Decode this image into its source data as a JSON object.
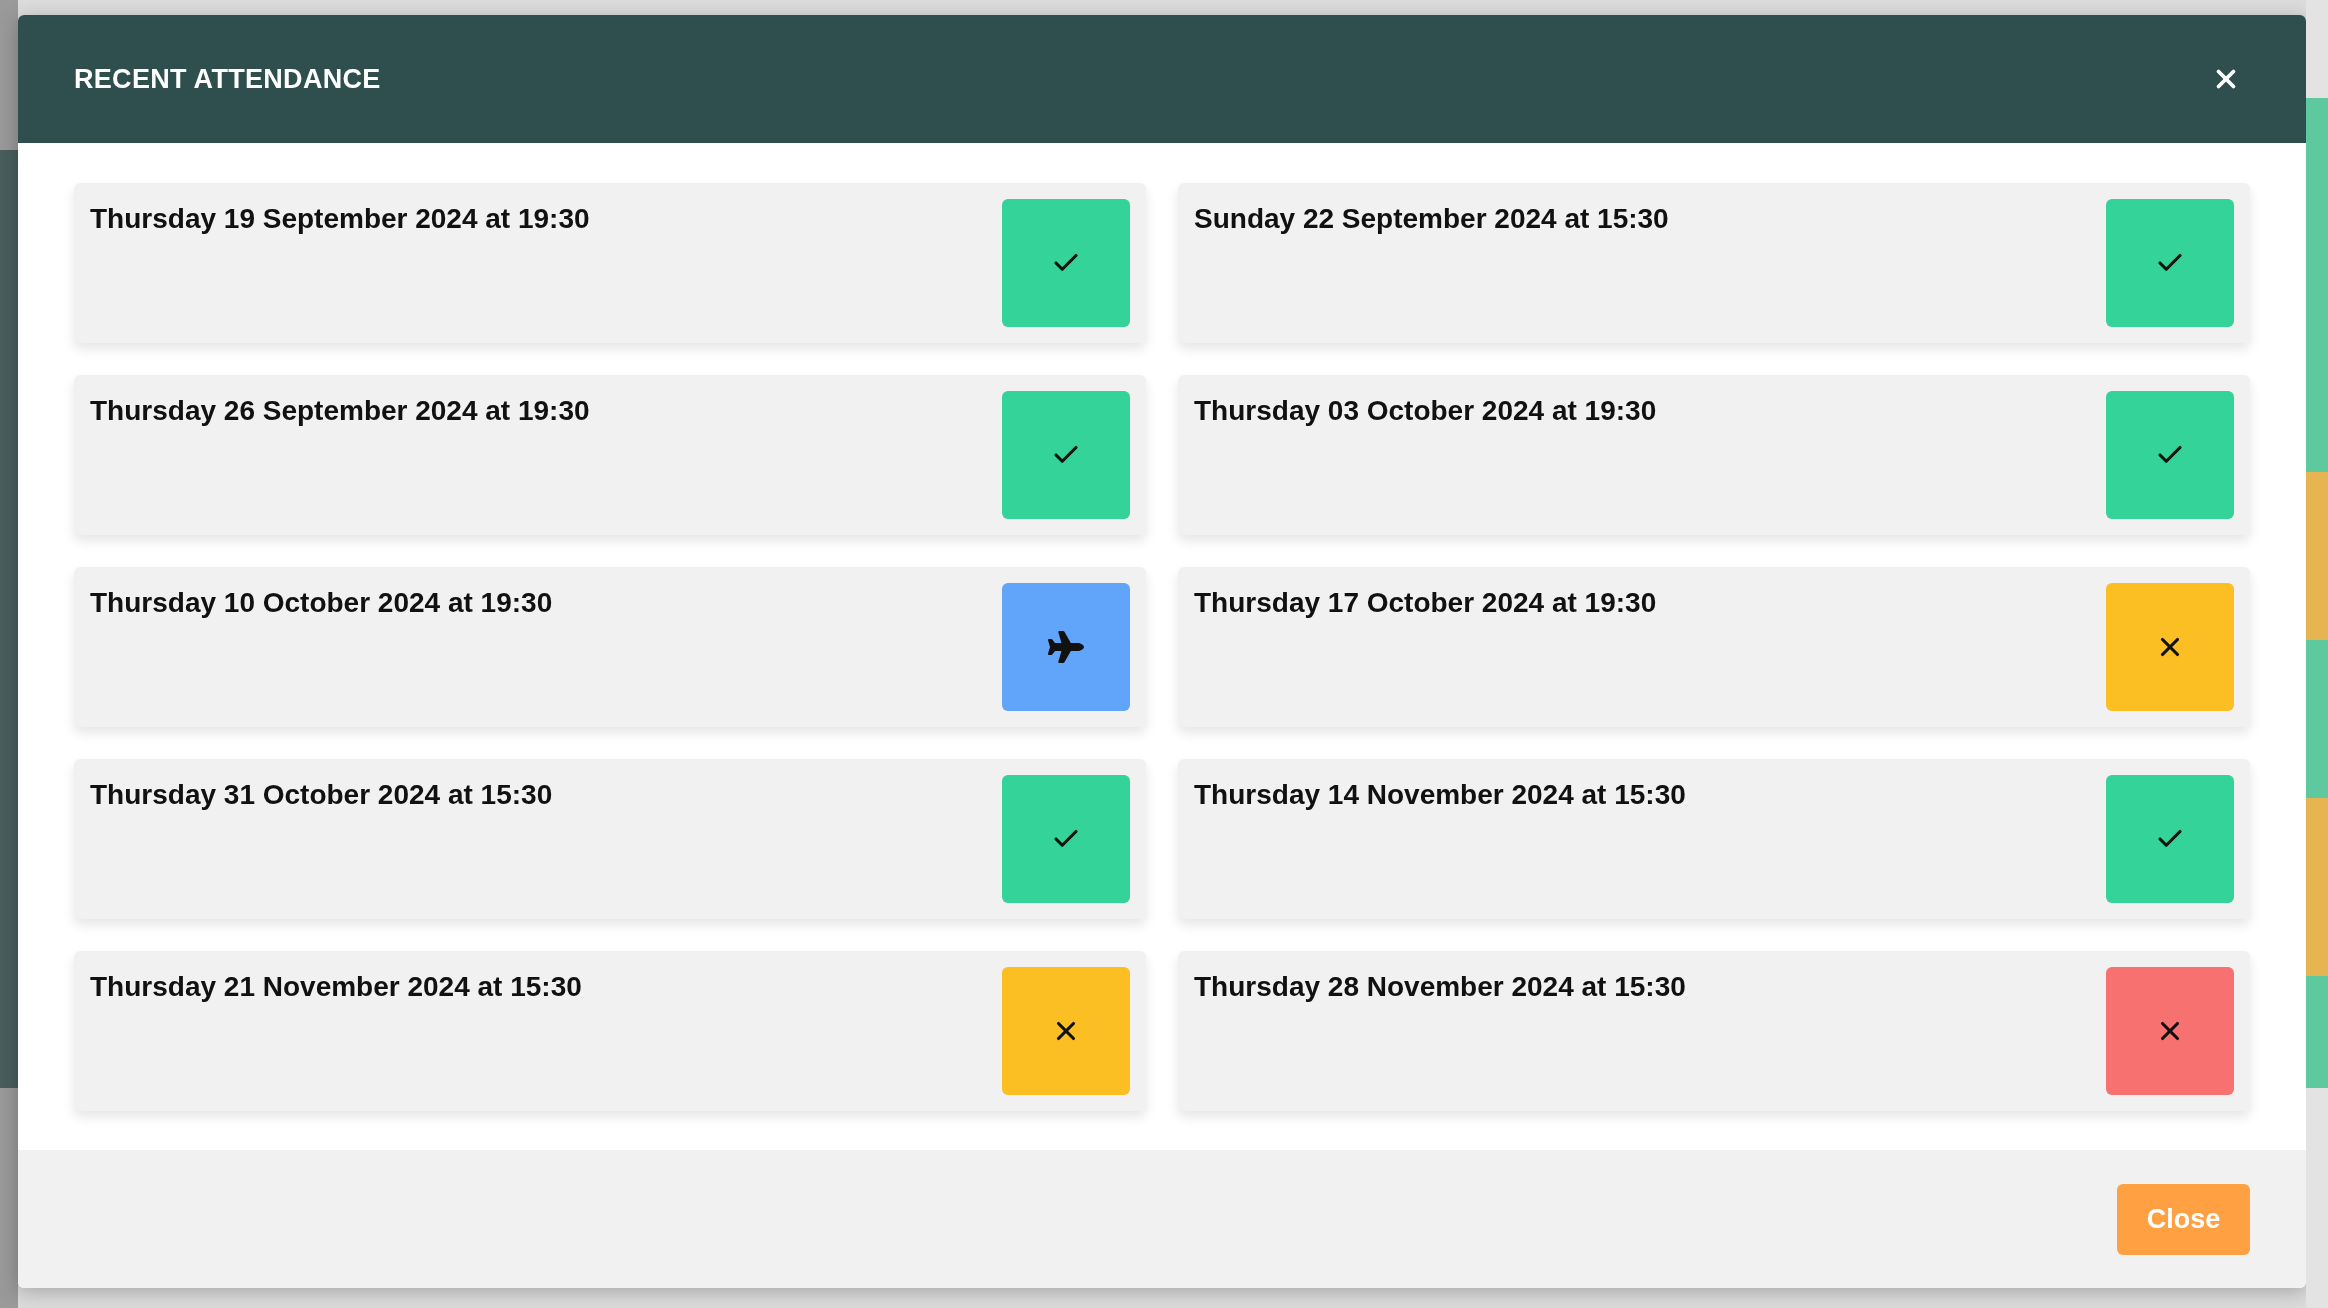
{
  "dialog": {
    "title": "RECENT ATTENDANCE",
    "close_button": "Close"
  },
  "records": [
    {
      "date": "Thursday 19 September 2024 at 19:30",
      "kind": "present"
    },
    {
      "date": "Sunday 22 September 2024 at 15:30",
      "kind": "present"
    },
    {
      "date": "Thursday 26 September 2024 at 19:30",
      "kind": "present"
    },
    {
      "date": "Thursday 03 October 2024 at 19:30",
      "kind": "present"
    },
    {
      "date": "Thursday 10 October 2024 at 19:30",
      "kind": "away"
    },
    {
      "date": "Thursday 17 October 2024 at 19:30",
      "kind": "excused"
    },
    {
      "date": "Thursday 31 October 2024 at 15:30",
      "kind": "present"
    },
    {
      "date": "Thursday 14 November 2024 at 15:30",
      "kind": "present"
    },
    {
      "date": "Thursday 21 November 2024 at 15:30",
      "kind": "excused"
    },
    {
      "date": "Thursday 28 November 2024 at 15:30",
      "kind": "absent"
    }
  ]
}
